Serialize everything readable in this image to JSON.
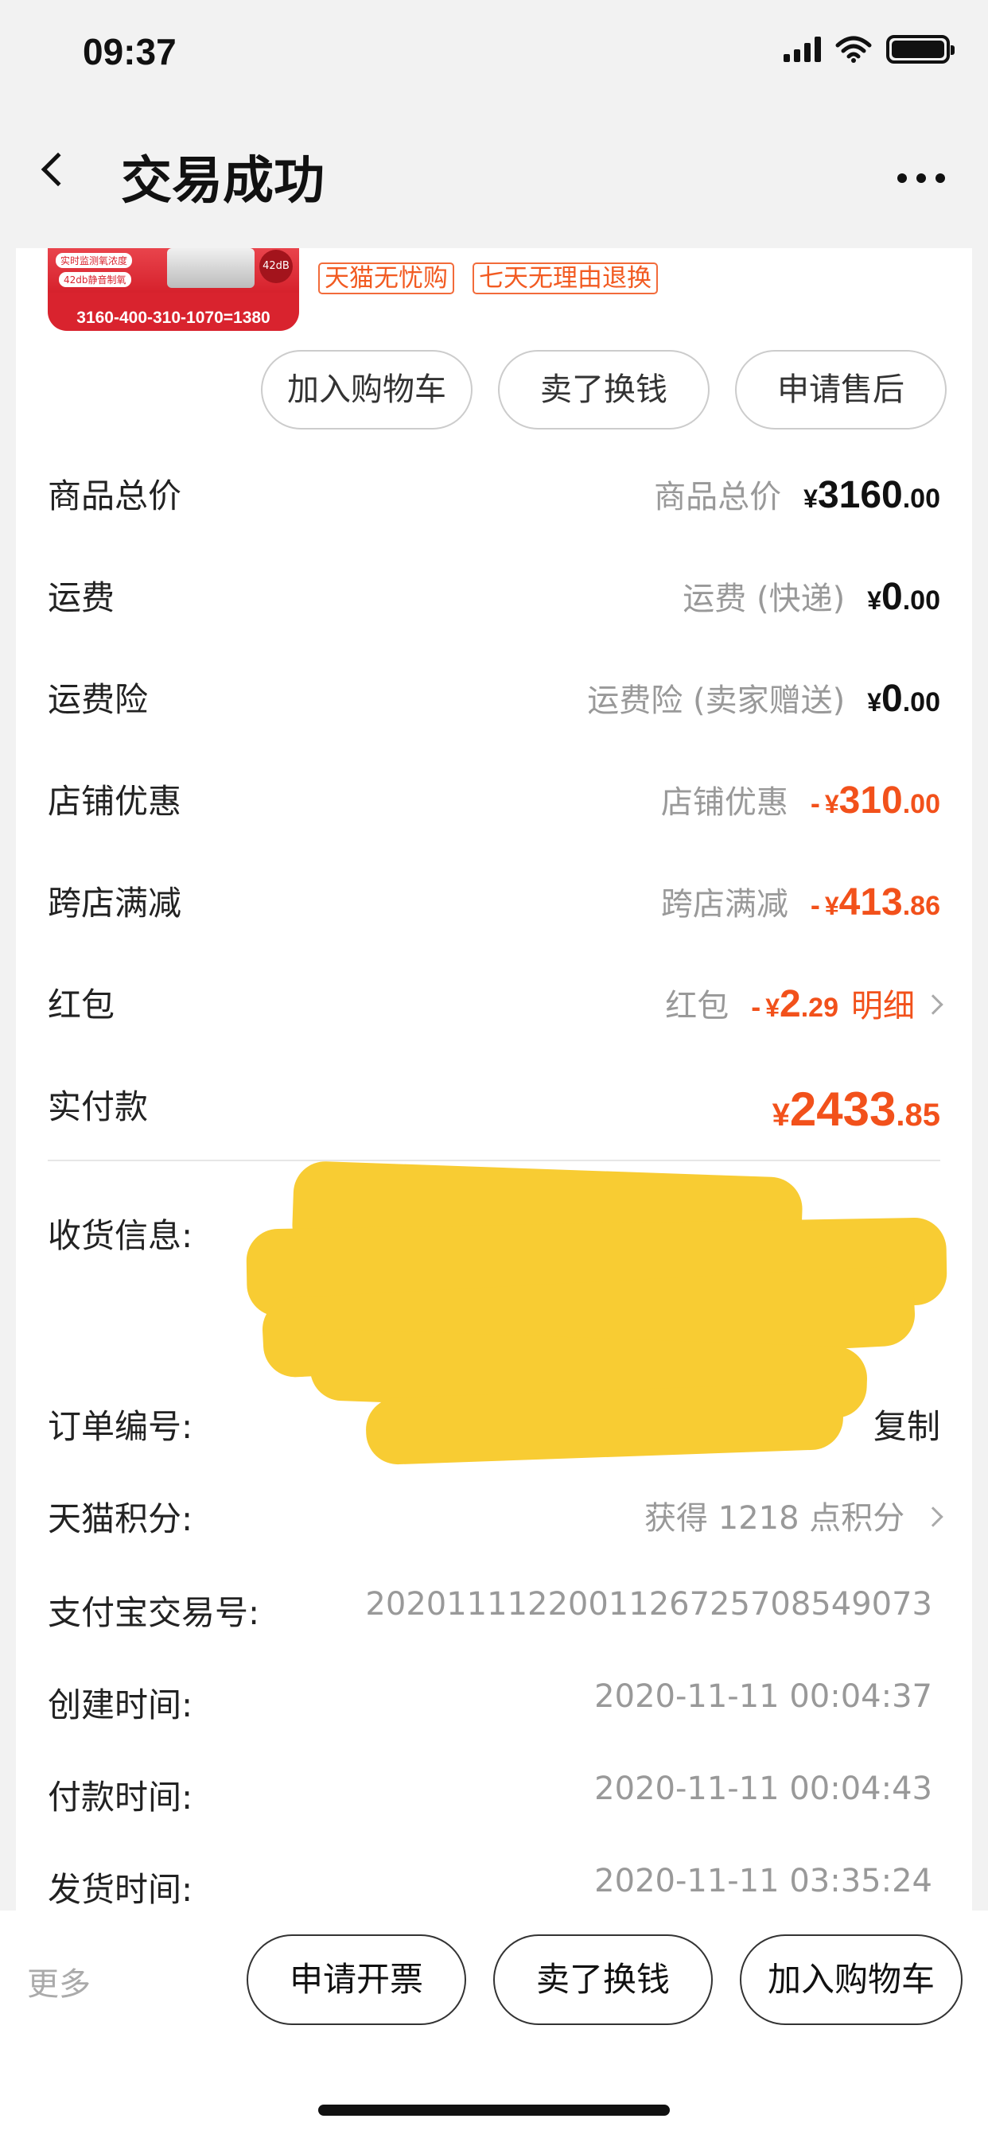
{
  "status": {
    "time": "09:37"
  },
  "nav": {
    "title": "交易成功"
  },
  "product": {
    "thumb_pills": [
      "实时监测氧浓度",
      "42db静音制氧"
    ],
    "thumb_badge": "42dB",
    "thumb_formula": "3160-400-310-1070=1380",
    "tags": [
      "天猫无忧购",
      "七天无理由退换"
    ]
  },
  "item_actions": [
    "加入购物车",
    "卖了换钱",
    "申请售后"
  ],
  "fees": [
    {
      "label": "商品总价",
      "sub": "商品总价",
      "minus": "",
      "yen": "¥",
      "int": "3160",
      "dec": ".00",
      "red": false
    },
    {
      "label": "运费",
      "sub": "运费 (快递)",
      "minus": "",
      "yen": "¥",
      "int": "0",
      "dec": ".00",
      "red": false
    },
    {
      "label": "运费险",
      "sub": "运费险 (卖家赠送)",
      "minus": "",
      "yen": "¥",
      "int": "0",
      "dec": ".00",
      "red": false
    },
    {
      "label": "店铺优惠",
      "sub": "店铺优惠",
      "minus": "-",
      "yen": "¥",
      "int": "310",
      "dec": ".00",
      "red": true
    },
    {
      "label": "跨店满减",
      "sub": "跨店满减",
      "minus": "-",
      "yen": "¥",
      "int": "413",
      "dec": ".86",
      "red": true
    },
    {
      "label": "红包",
      "sub": "红包",
      "minus": "-",
      "yen": "¥",
      "int": "2",
      "dec": ".29",
      "red": true,
      "link": "明细"
    }
  ],
  "paid": {
    "label": "实付款",
    "yen": "¥",
    "int": "2433",
    "dec": ".85"
  },
  "info": {
    "address_label": "收货信息:",
    "order_label": "订单编号:",
    "copy": "复制",
    "points_label": "天猫积分:",
    "points_value": "获得 1218 点积分",
    "alipay_label": "支付宝交易号:",
    "alipay_value": "2020111122001126725708549073",
    "created_label": "创建时间:",
    "created_value": "2020-11-11 00:04:37",
    "paid_label": "付款时间:",
    "paid_value": "2020-11-11 00:04:43",
    "shipped_label": "发货时间:",
    "shipped_value": "2020-11-11 03:35:24"
  },
  "bottom": {
    "more": "更多",
    "buttons": [
      "申请开票",
      "卖了换钱",
      "加入购物车"
    ]
  },
  "colors": {
    "accent": "#f2511b",
    "redaction": "#f8cc33"
  }
}
